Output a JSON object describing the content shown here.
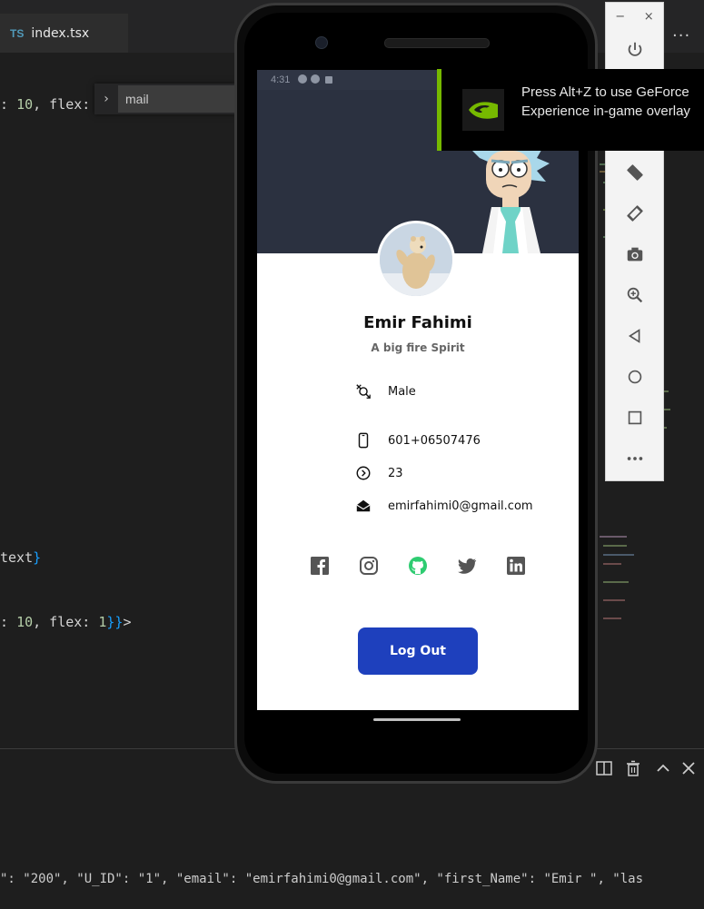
{
  "editor": {
    "tab_lang": "TS",
    "tab_name": "index.tsx",
    "tab_more": "...",
    "find_query": "mail",
    "line1_a": ": ",
    "line1_num": "10",
    "line1_b": ", flex:",
    "line2_a": "text",
    "line2_b": "}",
    "line3_a": ": ",
    "line3_num": "10",
    "line3_b": ", flex: ",
    "line3_num2": "1",
    "line3_c": "}}",
    "line3_d": ">"
  },
  "terminal": {
    "output": "\": \"200\", \"U_ID\": \"1\", \"email\": \"emirfahimi0@gmail.com\", \"first_Name\": \"Emir \", \"las"
  },
  "emulator": {
    "minimize": "−",
    "close": "×",
    "buttons": [
      "power-icon",
      "volume-up-icon",
      "volume-down-icon",
      "rotate-left-icon",
      "rotate-right-icon",
      "camera-icon",
      "zoom-icon",
      "back-icon",
      "home-icon",
      "overview-icon",
      "more-icon"
    ]
  },
  "phone": {
    "status_time": "4:31",
    "profile": {
      "name": "Emir Fahimi",
      "tagline": "A big fire Spirit",
      "gender": "Male",
      "phone": "601+06507476",
      "age": "23",
      "email": "emirfahimi0@gmail.com"
    },
    "socials": [
      "facebook-icon",
      "instagram-icon",
      "github-icon",
      "twitter-icon",
      "linkedin-icon"
    ],
    "logout_label": "Log Out"
  },
  "overlay": {
    "message": "Press Alt+Z to use GeForce Experience in-game overlay"
  },
  "colors": {
    "header_bg": "#2b3140",
    "button_blue": "#1e40bd",
    "github_accent": "#2ecc71",
    "nvidia_green": "#76b900"
  }
}
